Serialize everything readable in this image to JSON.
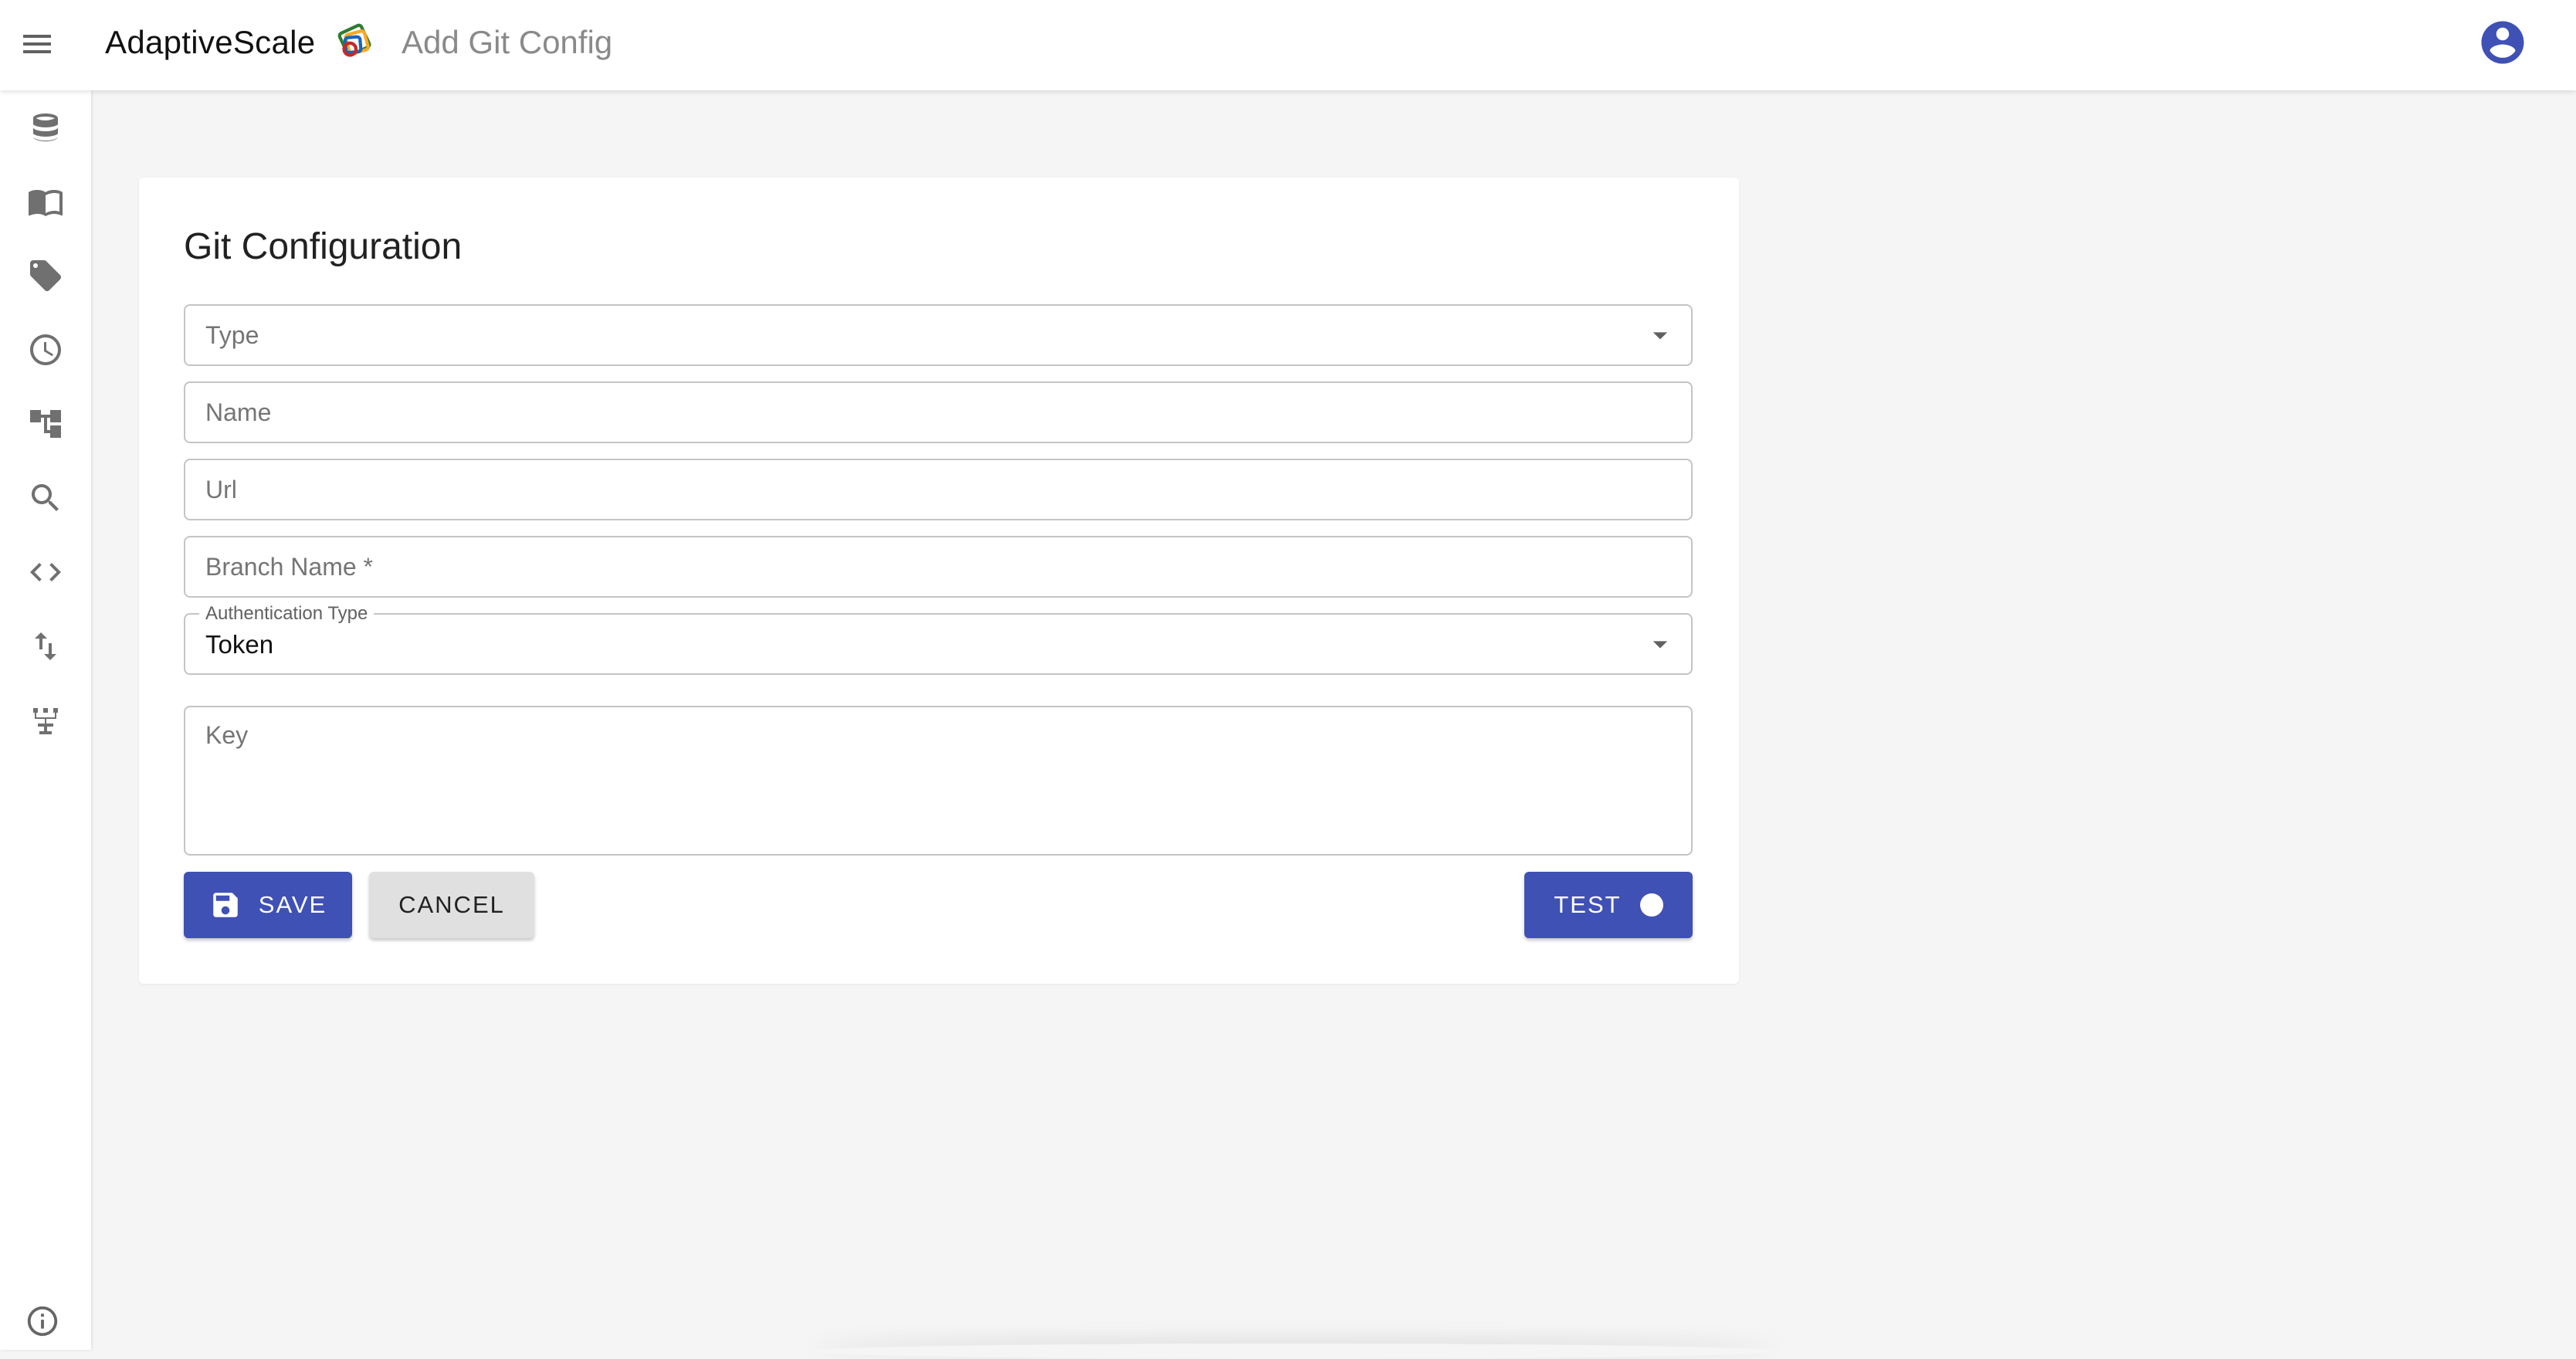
{
  "header": {
    "app_name": "AdaptiveScale",
    "page_title": "Add Git Config",
    "menu_icon": "menu-icon",
    "logo_icon": "adaptivescale-logo-icon",
    "account_icon": "account-circle-icon"
  },
  "sidebar": {
    "items": [
      {
        "icon": "database-icon"
      },
      {
        "icon": "book-icon"
      },
      {
        "icon": "tag-icon"
      },
      {
        "icon": "history-icon"
      },
      {
        "icon": "hierarchy-icon"
      },
      {
        "icon": "search-icon"
      },
      {
        "icon": "code-icon"
      },
      {
        "icon": "swap-vertical-icon"
      },
      {
        "icon": "lineage-icon"
      }
    ],
    "footer_icon": "info-icon"
  },
  "form": {
    "title": "Git Configuration",
    "fields": {
      "type": {
        "placeholder": "Type"
      },
      "name": {
        "placeholder": "Name"
      },
      "url": {
        "placeholder": "Url"
      },
      "branch": {
        "placeholder": "Branch Name *"
      },
      "auth_type": {
        "label": "Authentication Type",
        "value": "Token"
      },
      "key": {
        "placeholder": "Key"
      }
    },
    "buttons": {
      "save": "SAVE",
      "cancel": "CANCEL",
      "test": "TEST"
    }
  },
  "colors": {
    "primary": "#3f51b5",
    "background": "#f5f5f5",
    "secondary_button": "#e0e0e0"
  }
}
